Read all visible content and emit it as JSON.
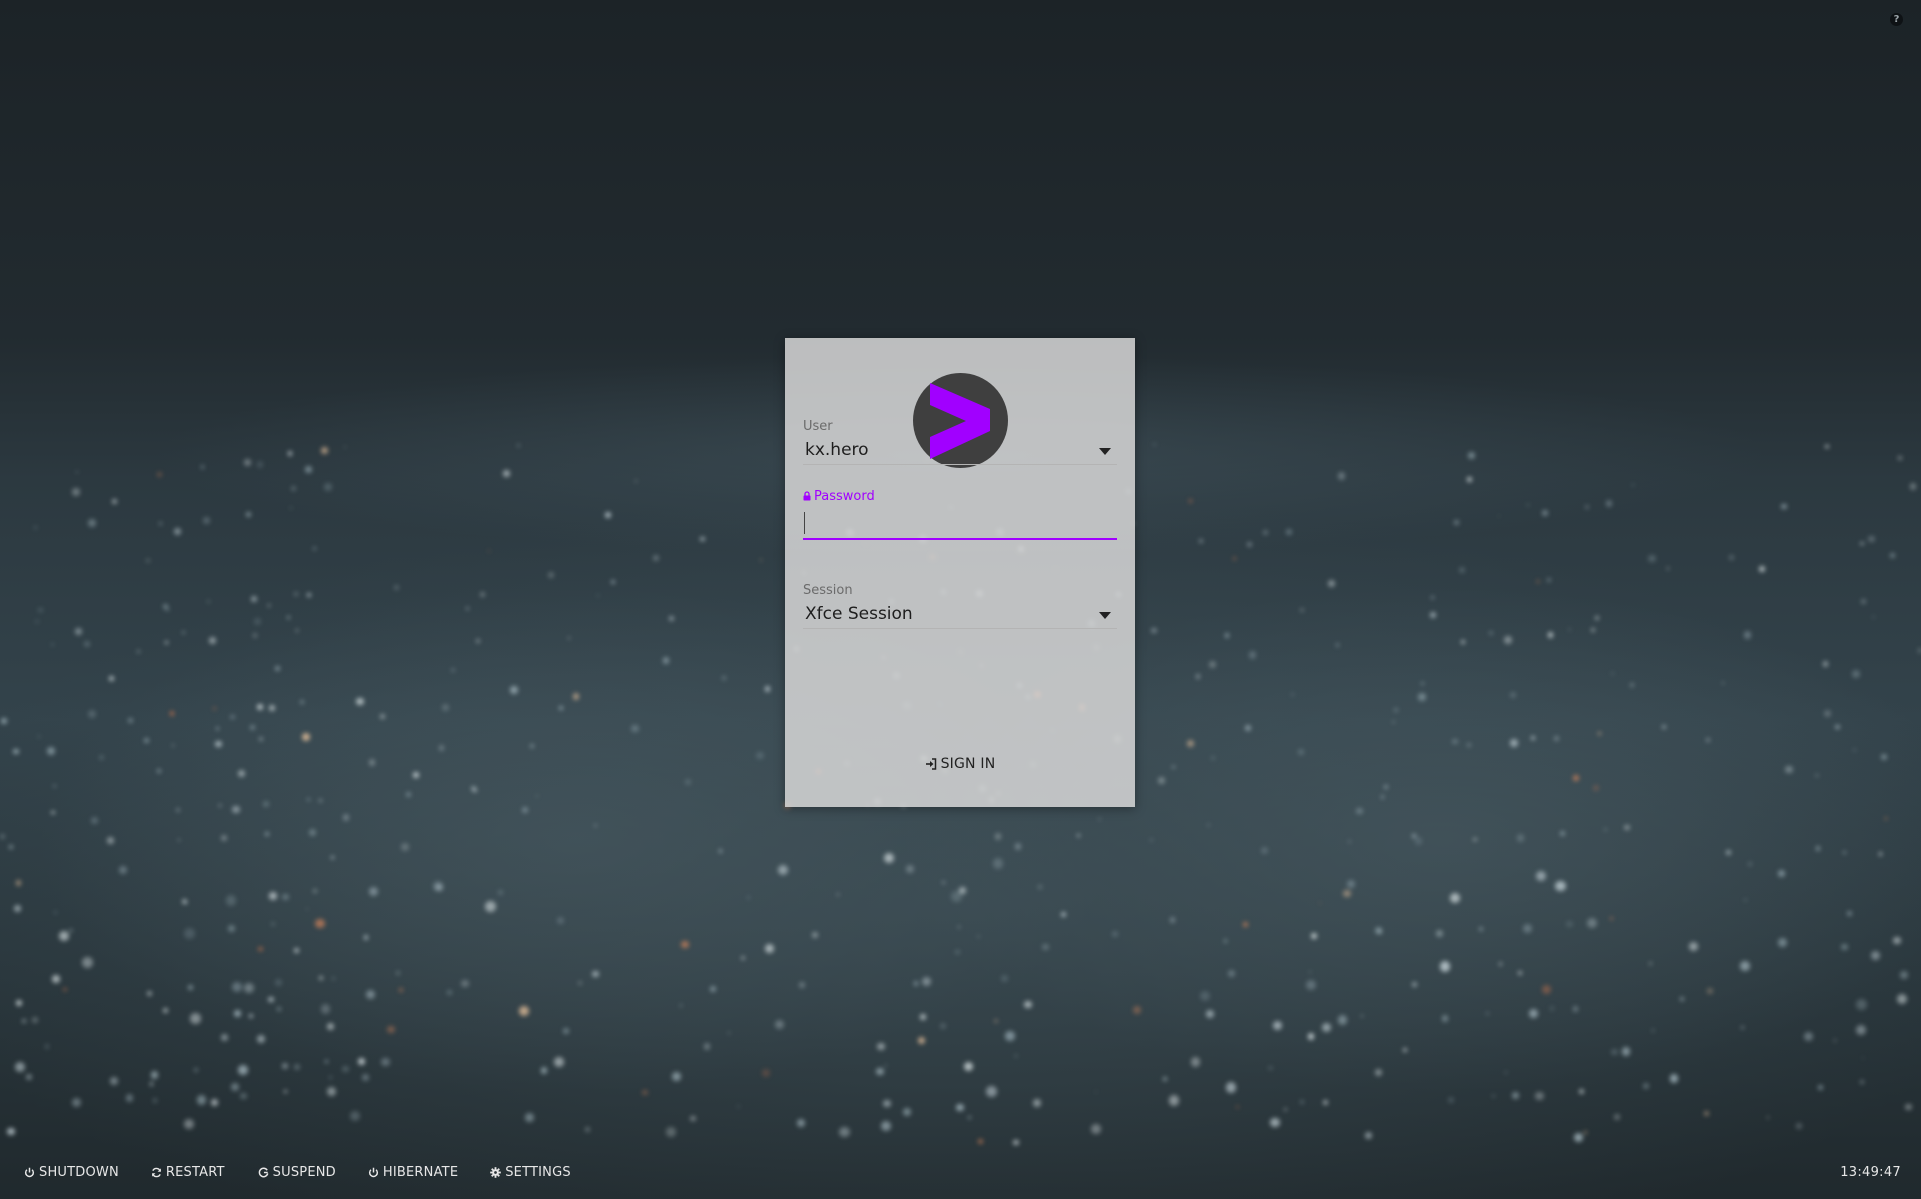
{
  "header": {
    "help_icon": "question-icon"
  },
  "login": {
    "logo_icon": "greater-than-logo",
    "accent_color": "#a100ff",
    "user": {
      "label": "User",
      "value": "kx.hero"
    },
    "password": {
      "label": "Password",
      "value": "",
      "icon": "lock-icon"
    },
    "session": {
      "label": "Session",
      "value": "Xfce Session"
    },
    "sign_in": {
      "label": "SIGN IN",
      "icon": "sign-in-icon"
    }
  },
  "bottom_bar": {
    "actions": [
      {
        "label": "SHUTDOWN",
        "icon": "power-icon"
      },
      {
        "label": "RESTART",
        "icon": "refresh-icon"
      },
      {
        "label": "SUSPEND",
        "icon": "suspend-icon"
      },
      {
        "label": "HIBERNATE",
        "icon": "power-icon"
      },
      {
        "label": "SETTINGS",
        "icon": "gear-icon"
      }
    ],
    "clock": "13:49:47"
  }
}
